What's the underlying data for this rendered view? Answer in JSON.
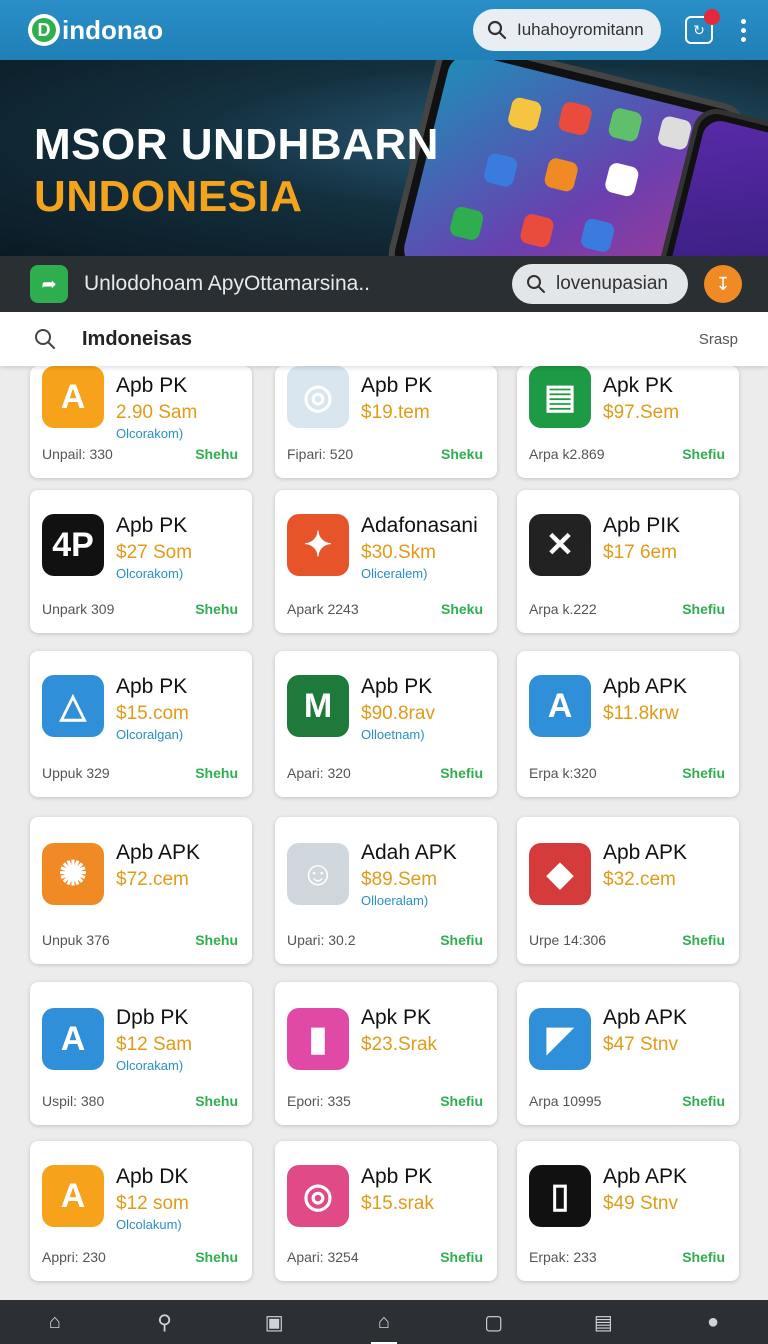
{
  "header": {
    "brand": "indonao",
    "brand_mark": "D",
    "search_text": "Iuhahoyromitann",
    "notification_badge": "",
    "icons": [
      "search-icon",
      "notification-icon",
      "more-icon"
    ]
  },
  "hero": {
    "title_line1": "MSOR UNDHBARN",
    "title_line2": "UNDONESIA"
  },
  "subbar": {
    "text": "Unlodohoam ApyOttamarsina..",
    "search_text": "lovenupasian"
  },
  "search": {
    "query": "Imdoneisas",
    "action": "Srasp"
  },
  "apps": [
    {
      "name": "Apb PK",
      "price": "2.90 Sam",
      "category": "Olcorakom)",
      "footer": "Unpail: 330",
      "action": "Shehu"
    },
    {
      "name": "Apb PK",
      "price": "$19.tem",
      "category": "",
      "footer": "Fipari: 520",
      "action": "Sheku"
    },
    {
      "name": "Apk PK",
      "price": "$97.Sem",
      "category": "",
      "footer": "Arpa k2.869",
      "action": "Shefiu"
    },
    {
      "name": "Apb PK",
      "price": "$27 Som",
      "category": "Olcorakom)",
      "footer": "Unpark 309",
      "action": "Shehu"
    },
    {
      "name": "Adafonasani",
      "price": "$30.Skm",
      "category": "Oliceralem)",
      "footer": "Apark 2243",
      "action": "Sheku"
    },
    {
      "name": "Apb PIK",
      "price": "$17 6em",
      "category": "",
      "footer": "Arpa k.222",
      "action": "Shefiu"
    },
    {
      "name": "Apb PK",
      "price": "$15.com",
      "category": "Olcoralgan)",
      "footer": "Uppuk 329",
      "action": "Shehu"
    },
    {
      "name": "Apb PK",
      "price": "$90.8rav",
      "category": "Olloetnam)",
      "footer": "Apari: 320",
      "action": "Shefiu"
    },
    {
      "name": "Apb APK",
      "price": "$11.8krw",
      "category": "",
      "footer": "Erpa k:320",
      "action": "Shefiu"
    },
    {
      "name": "Apb APK",
      "price": "$72.cem",
      "category": "",
      "footer": "Unpuk 376",
      "action": "Shehu"
    },
    {
      "name": "Adah APK",
      "price": "$89.Sem",
      "category": "Olloeralam)",
      "footer": "Upari: 30.2",
      "action": "Shefiu"
    },
    {
      "name": "Apb APK",
      "price": "$32.cem",
      "category": "",
      "footer": "Urpe 14:306",
      "action": "Shefiu"
    },
    {
      "name": "Dpb PK",
      "price": "$12 Sam",
      "category": "Olcorakam)",
      "footer": "Uspil: 380",
      "action": "Shehu"
    },
    {
      "name": "Apk PK",
      "price": "$23.Srak",
      "category": "",
      "footer": "Epori: 335",
      "action": "Shefiu"
    },
    {
      "name": "Apb APK",
      "price": "$47 Stnv",
      "category": "",
      "footer": "Arpa 10995",
      "action": "Shefiu"
    },
    {
      "name": "Apb DK",
      "price": "$12 som",
      "category": "Olcolakum)",
      "footer": "Appri: 230",
      "action": "Shehu"
    },
    {
      "name": "Apb PK",
      "price": "$15.srak",
      "category": "",
      "footer": "Apari: 3254",
      "action": "Shefiu"
    },
    {
      "name": "Apb APK",
      "price": "$49 Stnv",
      "category": "",
      "footer": "Erpak: 233",
      "action": "Shefiu"
    }
  ],
  "colors": {
    "brand_blue": "#1f7fb6",
    "price_orange": "#e39a18",
    "action_green": "#2fae4f",
    "nav_dark": "#2c3034"
  },
  "bottom_nav": [
    "home-icon",
    "explore-icon",
    "apps-icon",
    "store-icon",
    "square-icon",
    "library-icon",
    "profile-icon"
  ]
}
